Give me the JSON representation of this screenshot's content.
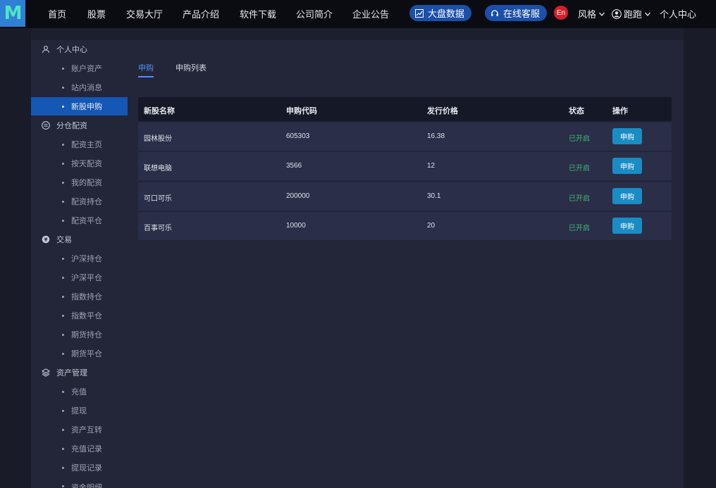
{
  "logo": {
    "letter": "M"
  },
  "nav": {
    "items": [
      "首页",
      "股票",
      "交易大厅",
      "产品介绍",
      "软件下载",
      "公司简介",
      "企业公告"
    ],
    "market_data": "大盘数据",
    "online_service": "在线客服",
    "lang": "En",
    "style": "风格",
    "user": "跑跑",
    "personal_center": "个人中心"
  },
  "sidebar": {
    "sections": [
      {
        "title": "个人中心",
        "icon": "user-icon",
        "items": [
          "账户资产",
          "站内消息",
          "新股申购"
        ]
      },
      {
        "title": "分仓配资",
        "icon": "swap-icon",
        "items": [
          "配资主页",
          "按天配资",
          "我的配资",
          "配资持仓",
          "配资平仓"
        ]
      },
      {
        "title": "交易",
        "icon": "yuan-coin-icon",
        "items": [
          "沪深持仓",
          "沪深平仓",
          "指数持仓",
          "指数平仓",
          "期货持仓",
          "期货平仓"
        ]
      },
      {
        "title": "资产管理",
        "icon": "layers-icon",
        "items": [
          "充值",
          "提现",
          "资产互转",
          "充值记录",
          "提现记录",
          "资金明细"
        ]
      }
    ],
    "active_item": "新股申购"
  },
  "tabs": [
    "申购",
    "申购列表"
  ],
  "table": {
    "headers": [
      "新股名称",
      "申购代码",
      "发行价格",
      "状态",
      "操作"
    ],
    "rows": [
      {
        "name": "园林股份",
        "code": "605303",
        "price": "16.38",
        "status": "已开启",
        "action": "申购"
      },
      {
        "name": "联想电脑",
        "code": "3566",
        "price": "12",
        "status": "已开启",
        "action": "申购"
      },
      {
        "name": "可口可乐",
        "code": "200000",
        "price": "30.1",
        "status": "已开启",
        "action": "申购"
      },
      {
        "name": "百事可乐",
        "code": "10000",
        "price": "20",
        "status": "已开启",
        "action": "申购"
      }
    ]
  },
  "colors": {
    "accent": "#1457b5",
    "tab_active": "#4f8ff0",
    "status_open": "#3fb87a",
    "button": "#1a8cc4"
  }
}
